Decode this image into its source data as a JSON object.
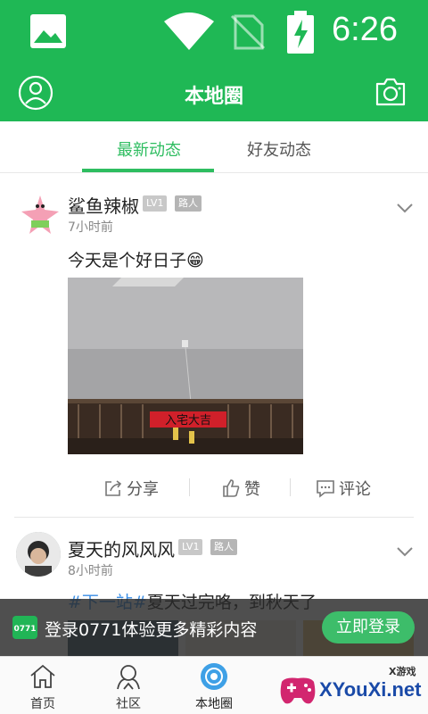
{
  "status_bar": {
    "time": "6:26"
  },
  "app_bar": {
    "title": "本地圈"
  },
  "tabs": [
    {
      "label": "最新动态",
      "active": true
    },
    {
      "label": "好友动态",
      "active": false
    }
  ],
  "posts": [
    {
      "username": "鲨鱼辣椒",
      "level": "LV1",
      "role": "路人",
      "time_ago": "7小时前",
      "text": "今天是个好日子😁",
      "image_text": "入宅大吉",
      "actions": {
        "share": "分享",
        "like": "赞",
        "comment": "评论"
      }
    },
    {
      "username": "夏天的风风风",
      "level": "LV1",
      "role": "路人",
      "time_ago": "8小时前",
      "hashtag": "#下一站#",
      "text": "夏天过完咯，到秋天了"
    }
  ],
  "login_banner": {
    "text": "登录0771体验更多精彩内容",
    "button": "立即登录"
  },
  "bottom_nav": [
    {
      "label": "首页",
      "icon": "home-icon"
    },
    {
      "label": "社区",
      "icon": "community-icon"
    },
    {
      "label": "本地圈",
      "icon": "local-circle-icon",
      "active": true
    },
    {
      "label": "",
      "icon": "nav-icon-4"
    },
    {
      "label": "",
      "icon": "nav-icon-5"
    }
  ],
  "watermark": {
    "text": "XYouXi.net",
    "small": "X游戏"
  },
  "colors": {
    "brand_green": "#1fb855",
    "accent": "#2ebd60",
    "hashtag": "#3a8ee6"
  }
}
